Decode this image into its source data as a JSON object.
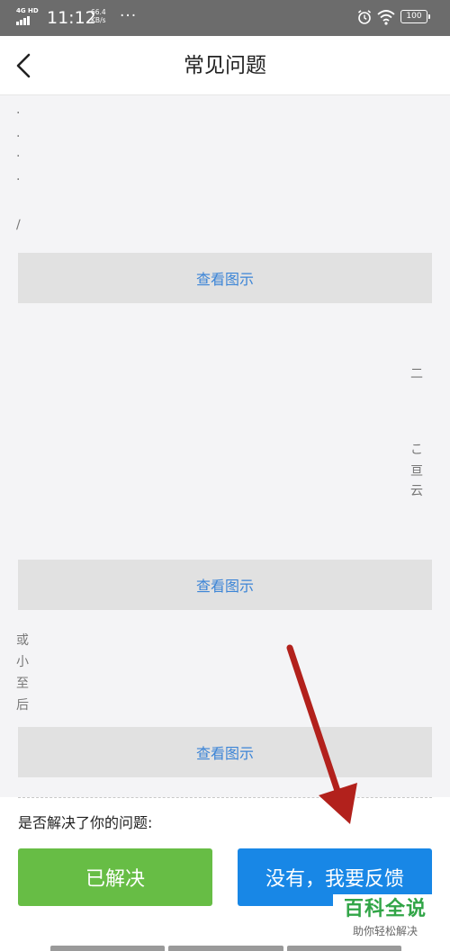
{
  "status_bar": {
    "network": "4G HD",
    "time": "11:12",
    "speed_value": "66.4",
    "speed_unit": "KB/s",
    "more": "···",
    "battery": "100",
    "icons": [
      "signal-icon",
      "alarm-icon",
      "wifi-icon",
      "battery-icon"
    ]
  },
  "nav": {
    "title": "常见问题",
    "back_icon": "chevron-left-icon"
  },
  "content": {
    "left_fragments_top": [
      ".",
      ".",
      "·",
      "·",
      "∕"
    ],
    "right_fragments_mid": [
      "二",
      "こ",
      "亘",
      "云"
    ],
    "left_fragments_bottom": [
      "或",
      "小",
      "至",
      "后"
    ],
    "view_buttons": [
      "查看图示",
      "查看图示",
      "查看图示"
    ]
  },
  "feedback": {
    "question": "是否解决了你的问题:",
    "solved_label": "已解决",
    "feedback_label": "没有，我要反馈"
  },
  "watermark": {
    "main": "百科全说",
    "sub": "助你轻松解决"
  },
  "colors": {
    "status_bar": "#6c6c6c",
    "content_bg": "#f4f4f6",
    "view_button_bg": "#e1e1e1",
    "link_blue": "#3b84d6",
    "solved_green": "#67bd45",
    "feedback_blue": "#1887e6",
    "annotation_arrow": "#b2211c",
    "logo_green": "#31a547"
  }
}
